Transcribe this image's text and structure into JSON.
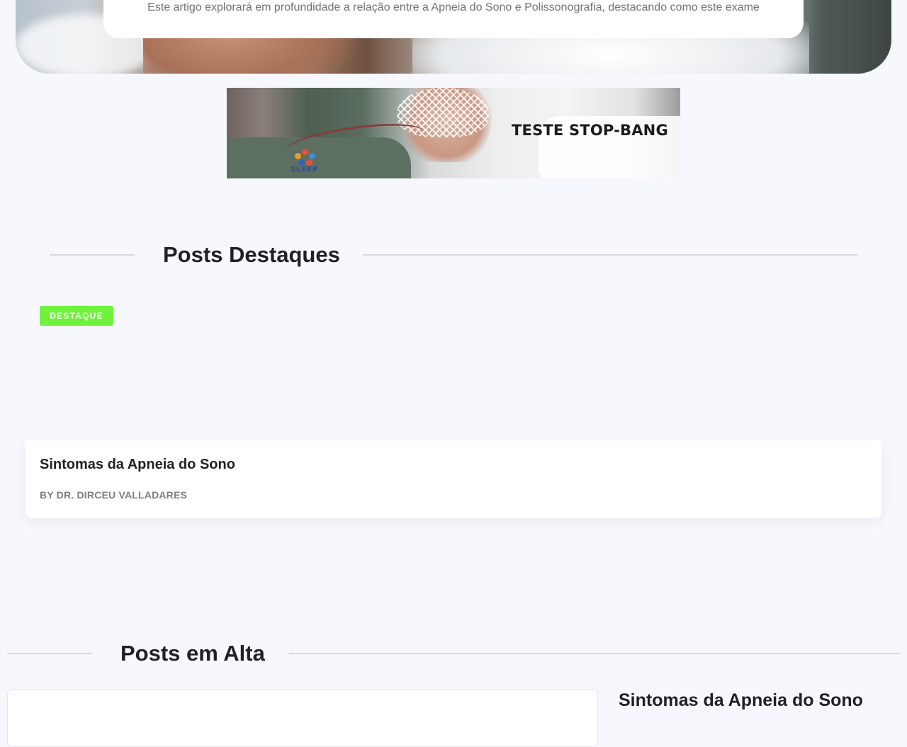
{
  "hero": {
    "excerpt": "Este artigo explorará em profundidade a relação entre a Apneia do Sono e Polissonografia, destacando como este exame"
  },
  "banner": {
    "text": "TESTE STOP-BANG",
    "logo_text": "SLEEP",
    "logo_icon": "sleep-logo-icon"
  },
  "featured_section": {
    "title": "Posts Destaques",
    "badge": "DESTAQUE",
    "post": {
      "title": "Sintomas da Apneia do Sono",
      "author": "BY DR. DIRCEU VALLADARES"
    }
  },
  "trending_section": {
    "title": "Posts em Alta",
    "side_post_title": "Sintomas da Apneia do Sono"
  },
  "colors": {
    "background": "#f7f8fd",
    "badge_green": "#6ef23c",
    "text_dark": "#1f2126",
    "text_muted": "#7b7e85"
  }
}
